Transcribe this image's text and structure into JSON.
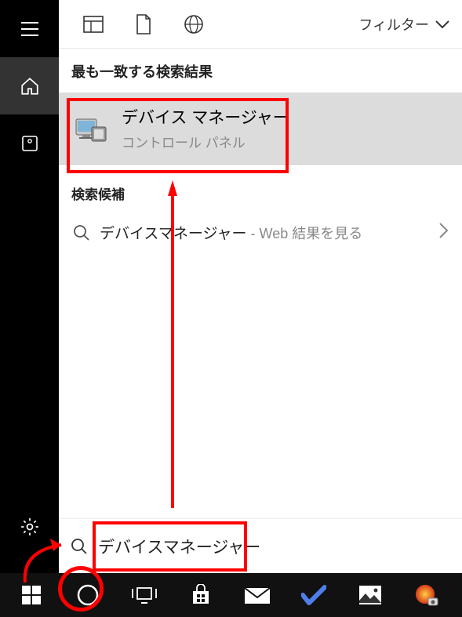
{
  "toolbar": {
    "filter_label": "フィルター"
  },
  "best_match": {
    "header": "最も一致する検索結果",
    "title": "デバイス マネージャー",
    "subtitle": "コントロール パネル"
  },
  "suggestions": {
    "header": "検索候補",
    "item": {
      "title": "デバイスマネージャー",
      "subtitle": " - Web 結果を見る"
    }
  },
  "search": {
    "value": "デバイスマネージャー",
    "placeholder": ""
  },
  "sidebar_icons": {
    "hamburger": "hamburger-icon",
    "home": "home-icon",
    "recent": "recent-icon",
    "settings": "settings-icon",
    "feedback": "feedback-icon"
  },
  "toolbar_icons": {
    "apps": "apps-icon",
    "document": "document-icon",
    "web": "web-icon"
  },
  "taskbar_icons": {
    "start": "start-icon",
    "cortana": "cortana-icon",
    "taskview": "taskview-icon",
    "store": "store-icon",
    "mail": "mail-icon",
    "todo": "todo-icon",
    "photos": "photos-icon",
    "camera": "camera-icon"
  }
}
